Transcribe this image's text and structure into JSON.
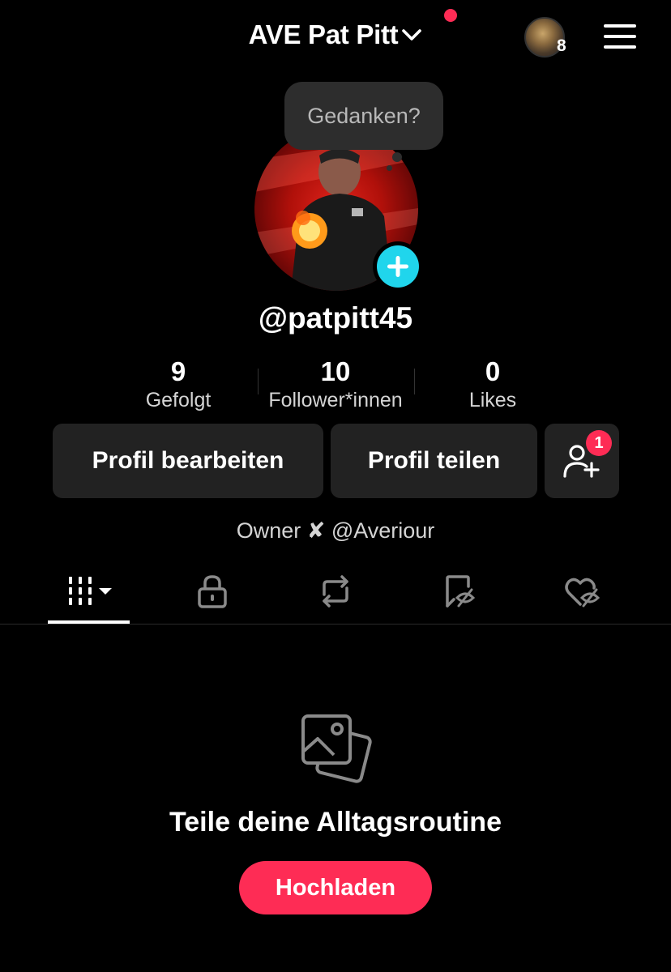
{
  "header": {
    "account_name": "AVE Pat Pitt",
    "story_count": "8",
    "notification_color": "#fe2c55"
  },
  "bubble": {
    "text": "Gedanken?"
  },
  "profile": {
    "username": "@patpitt45",
    "bio": "Owner ✘ @Averiour"
  },
  "stats": [
    {
      "value": "9",
      "label": "Gefolgt"
    },
    {
      "value": "10",
      "label": "Follower*innen"
    },
    {
      "value": "0",
      "label": "Likes"
    }
  ],
  "actions": {
    "edit_label": "Profil bearbeiten",
    "share_label": "Profil teilen",
    "add_friends_badge": "1"
  },
  "tabs": [
    {
      "icon": "grid-icon",
      "active": true
    },
    {
      "icon": "lock-icon",
      "active": false
    },
    {
      "icon": "repost-icon",
      "active": false
    },
    {
      "icon": "bookmark-hidden-icon",
      "active": false
    },
    {
      "icon": "heart-hidden-icon",
      "active": false
    }
  ],
  "empty_state": {
    "icon": "photos-icon",
    "title": "Teile deine Alltagsroutine",
    "button_label": "Hochladen"
  },
  "colors": {
    "accent": "#fe2c55",
    "add_button": "#20d5ec",
    "surface": "#222222"
  }
}
